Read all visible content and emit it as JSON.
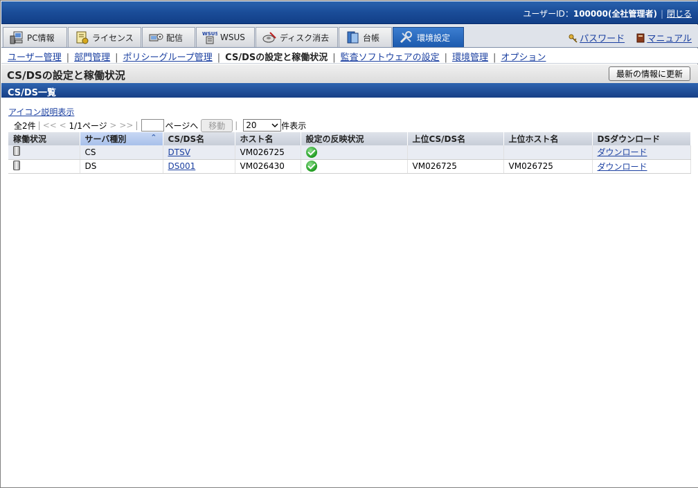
{
  "header": {
    "user_prefix": "ユーザーID：",
    "user_value": "100000(全社管理者)",
    "close_label": "閉じる"
  },
  "tabs": [
    {
      "label": "PC情報",
      "icon": "pc-icon"
    },
    {
      "label": "ライセンス",
      "icon": "license-icon"
    },
    {
      "label": "配信",
      "icon": "delivery-icon"
    },
    {
      "label": "WSUS",
      "icon": "wsus-icon"
    },
    {
      "label": "ディスク消去",
      "icon": "disk-erase-icon"
    },
    {
      "label": "台帳",
      "icon": "ledger-icon"
    },
    {
      "label": "環境設定",
      "icon": "settings-icon",
      "active": true
    }
  ],
  "right_links": {
    "password": "パスワード",
    "manual": "マニュアル"
  },
  "subnav": [
    {
      "label": "ユーザー管理"
    },
    {
      "label": "部門管理"
    },
    {
      "label": "ポリシーグループ管理"
    },
    {
      "label": "CS/DSの設定と稼働状況",
      "current": true
    },
    {
      "label": "監査ソフトウェアの設定"
    },
    {
      "label": "環境管理"
    },
    {
      "label": "オプション"
    }
  ],
  "page": {
    "title": "CS/DSの設定と稼働状況",
    "refresh_label": "最新の情報に更新"
  },
  "section": {
    "title": "CS/DS一覧",
    "icon_legend": "アイコン説明表示"
  },
  "pager": {
    "total": "全2件",
    "first": "<<",
    "prev": "<",
    "page_info": "1/1ページ",
    "next": ">",
    "last": ">>",
    "page_input": "",
    "goto_suffix": "ページへ",
    "move_label": "移動",
    "per_page": "20",
    "per_page_suffix": "件表示"
  },
  "table": {
    "columns": [
      "稼働状況",
      "サーバ種別",
      "CS/DS名",
      "ホスト名",
      "設定の反映状況",
      "上位CS/DS名",
      "上位ホスト名",
      "DSダウンロード"
    ],
    "rows": [
      {
        "server_type": "CS",
        "name": "DTSV",
        "host": "VM026725",
        "parent_name": "",
        "parent_host": "",
        "download": "ダウンロード"
      },
      {
        "server_type": "DS",
        "name": "DS001",
        "host": "VM026430",
        "parent_name": "VM026725",
        "parent_host": "VM026725",
        "download": "ダウンロード"
      }
    ]
  }
}
